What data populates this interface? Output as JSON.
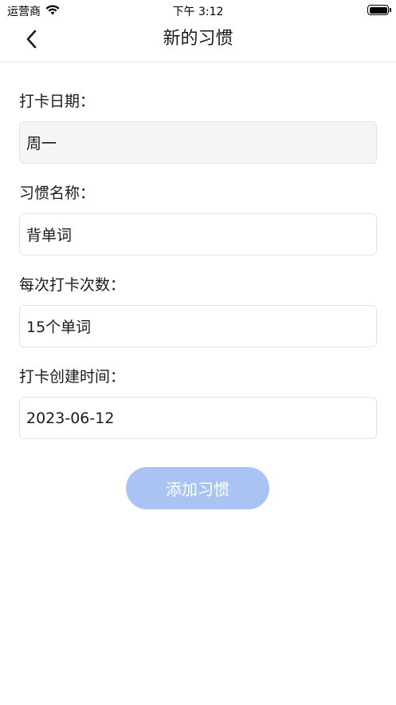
{
  "status_bar": {
    "carrier": "运营商",
    "time": "下午 3:12",
    "battery_level": 1.0
  },
  "nav": {
    "title": "新的习惯",
    "back_icon": "chevron-left-icon"
  },
  "form": {
    "checkin_day": {
      "label": "打卡日期：",
      "value": "周一"
    },
    "habit_name": {
      "label": "习惯名称：",
      "value": "背单词"
    },
    "times_per_checkin": {
      "label": "每次打卡次数：",
      "value": "15个单词"
    },
    "created_time": {
      "label": "打卡创建时间：",
      "value": "2023-06-12"
    }
  },
  "actions": {
    "add_label": "添加习惯"
  },
  "colors": {
    "primary_button": "#a9c4f2",
    "readonly_field": "#f5f5f5",
    "divider": "#e6e6e6"
  }
}
